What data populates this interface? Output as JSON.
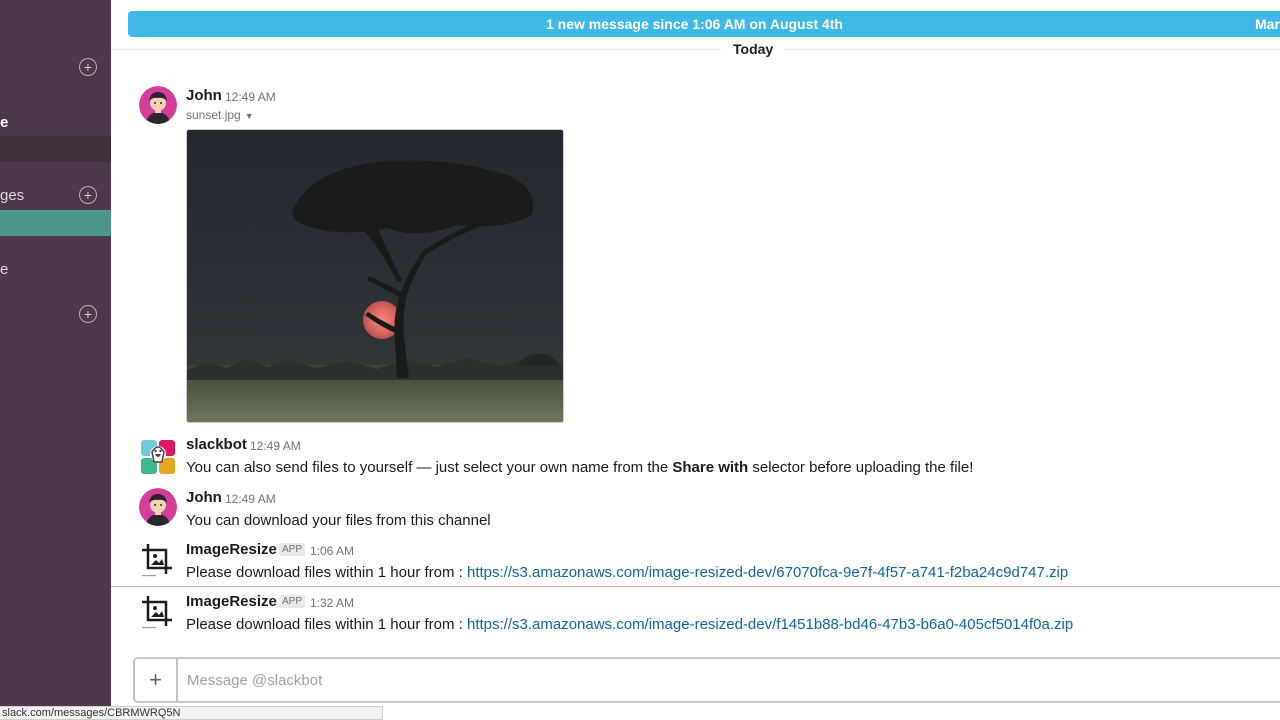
{
  "sidebar": {
    "labels": [
      {
        "text": "e",
        "bold": true
      },
      {
        "text": "ges",
        "bold": false
      },
      {
        "text": "e",
        "bold": false
      }
    ]
  },
  "banner": {
    "text": "1 new message since 1:06 AM on August 4th",
    "mark": "Mar"
  },
  "day_divider": {
    "label": "Today"
  },
  "messages": [
    {
      "author": "John",
      "time": "12:49 AM",
      "file_name": "sunset.jpg"
    },
    {
      "author": "slackbot",
      "time": "12:49 AM",
      "text_before": "You can also send files to yourself — just select your own name from the ",
      "text_bold": "Share with",
      "text_after": " selector before uploading the file!"
    },
    {
      "author": "John",
      "time": "12:49 AM",
      "text": "You can download your files from this channel"
    },
    {
      "author": "ImageResize",
      "badge": "APP",
      "time": "1:06 AM",
      "text": "Please download files within 1 hour from : ",
      "link": "https://s3.amazonaws.com/image-resized-dev/67070fca-9e7f-4f57-a741-f2ba24c9d747.zip"
    },
    {
      "author": "ImageResize",
      "badge": "APP",
      "time": "1:32 AM",
      "text": "Please download files within 1 hour from : ",
      "link": "https://s3.amazonaws.com/image-resized-dev/f1451b88-bd46-47b3-b6a0-405cf5014f0a.zip"
    }
  ],
  "composer": {
    "plus": "+",
    "placeholder": "Message @slackbot",
    "value": ""
  },
  "status_bar": {
    "url": "slack.com/messages/CBRMWRQ5N"
  },
  "icons": {
    "add": "circle-plus-icon",
    "file_caret": "caret-down-icon",
    "app_avatar": "image-resize-icon"
  },
  "colors": {
    "sidebar": "#4d394b",
    "sidebar_active": "#4c9689",
    "banner": "#3fb8e5",
    "link": "#1264a3",
    "new_line": "#e8a6a6"
  }
}
